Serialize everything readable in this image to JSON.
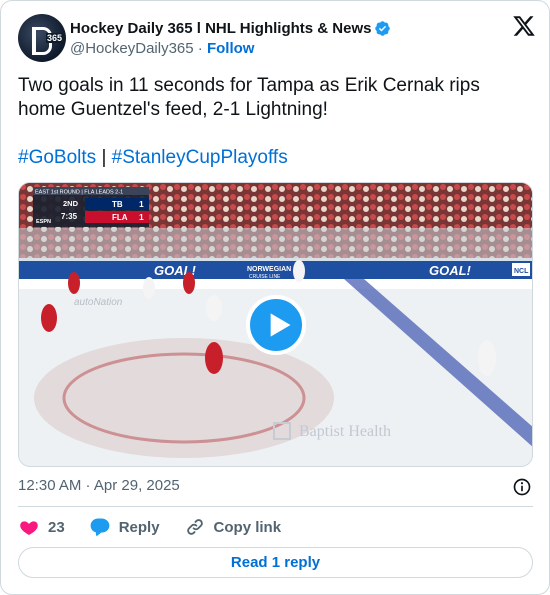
{
  "account": {
    "display_name": "Hockey Daily 365 l NHL Highlights & News",
    "handle": "@HockeyDaily365",
    "separator": "·",
    "follow_label": "Follow",
    "avatar_text": "365"
  },
  "tweet": {
    "text": "Two goals in 11 seconds for Tampa as Erik Cernak rips home Guentzel's feed, 2-1 Lightning!",
    "hashtags": [
      "#GoBolts",
      "#StanleyCupPlayoffs"
    ],
    "hashtag_separator": "|"
  },
  "video": {
    "scorebug": {
      "round": "EAST 1st ROUND | FLA LEADS 2-1",
      "period": "2ND",
      "clock": "7:35",
      "network": "ESPN",
      "teams": [
        {
          "abbr": "TB",
          "score": "1"
        },
        {
          "abbr": "FLA",
          "score": "1"
        }
      ]
    },
    "boards": [
      "GOAL!",
      "NORWEGIAN",
      "CRUISE LINE",
      "GOAL!",
      "NCL",
      "autoNation"
    ],
    "ice_ad": "Baptist Health",
    "colors": {
      "play_button": "#1d9bf0"
    }
  },
  "meta": {
    "timestamp": "12:30 AM · Apr 29, 2025"
  },
  "actions": {
    "like_count": "23",
    "reply_label": "Reply",
    "copy_label": "Copy link"
  },
  "footer": {
    "read_replies": "Read 1 reply"
  },
  "icons": {
    "verified": "verified-badge-icon",
    "brand": "x-logo-icon",
    "info": "info-icon",
    "like": "heart-icon",
    "reply": "speech-bubble-icon",
    "copy": "link-icon",
    "play": "play-icon"
  },
  "colors": {
    "accent": "#006fd6",
    "verified": "#1d9bf0",
    "like": "#f91880",
    "muted": "#536471",
    "border": "#cfd9de"
  }
}
